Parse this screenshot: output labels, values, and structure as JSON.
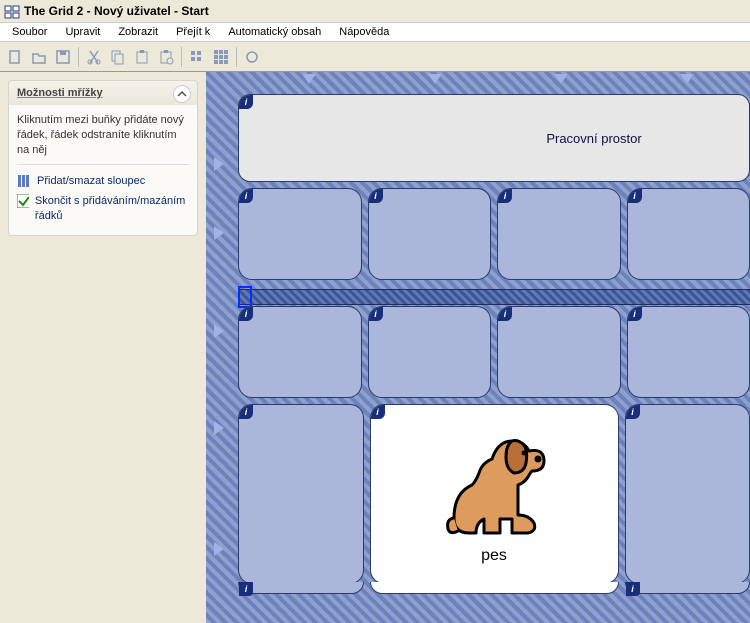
{
  "window": {
    "title": "The Grid 2 - Nový uživatel - Start"
  },
  "menus": {
    "file": "Soubor",
    "edit": "Upravit",
    "view": "Zobrazit",
    "goto": "Přejít k",
    "auto": "Automatický obsah",
    "help": "Nápověda"
  },
  "side": {
    "panel_title": "Možnosti mřížky",
    "hint": "Kliknutím mezi buňky přidáte nový řádek, řádek odstraníte kliknutím na něj",
    "opt_cols": "Přidat/smazat sloupec",
    "opt_done": "Skončit s přidáváním/mazáním řádků"
  },
  "workspace": {
    "label": "Pracovní prostor"
  },
  "cells": {
    "dog_label": "pes"
  },
  "info_marker": "i"
}
